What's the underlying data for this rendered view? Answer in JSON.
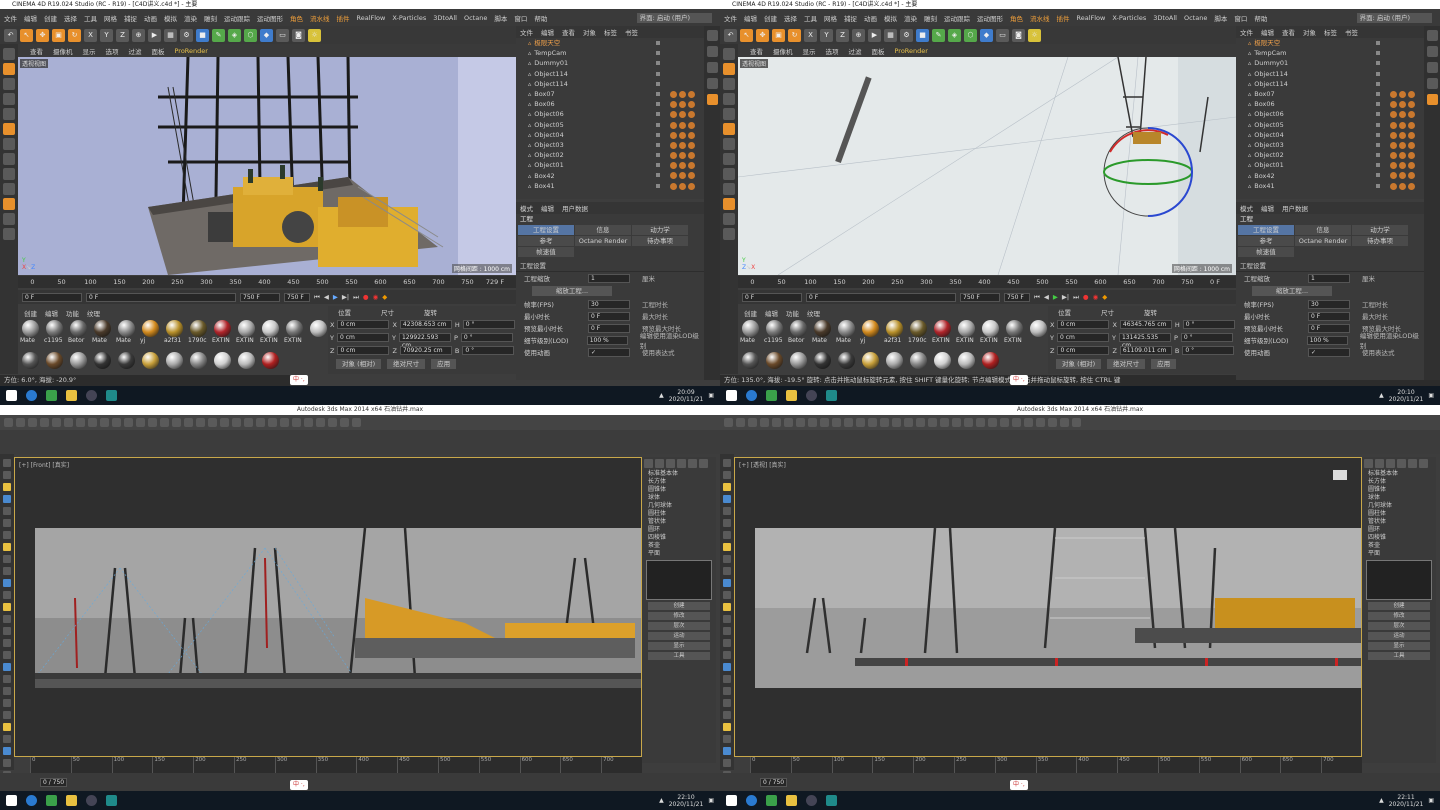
{
  "c4d_left": {
    "title": "CINEMA 4D R19.024 Studio (RC - R19) - [C4D讲义.c4d *] - 主要",
    "menus": [
      "文件",
      "编辑",
      "创建",
      "选择",
      "工具",
      "网格",
      "捕捉",
      "动画",
      "模拟",
      "渲染",
      "雕刻",
      "运动跟踪",
      "运动图形",
      "角色",
      "流水线",
      "插件",
      "RealFlow",
      "X-Particles",
      "3DtoAll",
      "Octane",
      "脚本",
      "窗口",
      "帮助"
    ],
    "layout_label": "界面",
    "layout_value": "启动 (用户)",
    "viewport_menus": [
      "查看",
      "摄像机",
      "显示",
      "选项",
      "过滤",
      "面板"
    ],
    "prorender": "ProRender",
    "viewport_name": "透视视图",
    "grid_spacing": "网格间距 : 1000 cm",
    "timeline_ticks": [
      "0",
      "50",
      "100",
      "150",
      "200",
      "250",
      "300",
      "350",
      "400",
      "450",
      "500",
      "550",
      "600",
      "650",
      "700",
      "750"
    ],
    "frame_end": "729 F",
    "transport": {
      "start": "0 F",
      "current": "0 F",
      "end": "750 F",
      "end2": "750 F"
    },
    "mat_tabs": [
      "创建",
      "编辑",
      "功能",
      "纹理"
    ],
    "materials": [
      {
        "name": "Mate",
        "color": "#9a9a9a"
      },
      {
        "name": "c1195",
        "color": "#7a7a7a"
      },
      {
        "name": "Betor",
        "color": "#6a6a6a"
      },
      {
        "name": "Mate",
        "color": "#4a3a2a"
      },
      {
        "name": "Mate",
        "color": "#8a8a8a"
      },
      {
        "name": "yj",
        "color": "#d28a1e"
      },
      {
        "name": "a2f31",
        "color": "#b8902a"
      },
      {
        "name": "1790c",
        "color": "#6a5a2a"
      },
      {
        "name": "EXTIN",
        "color": "#b0242a"
      },
      {
        "name": "EXTIN",
        "color": "#a8a8a8"
      },
      {
        "name": "EXTIN",
        "color": "#c8c8c8"
      },
      {
        "name": "EXTIN",
        "color": "#777"
      },
      {
        "name": "",
        "color": "#bcbcbc"
      },
      {
        "name": "",
        "color": "#555"
      },
      {
        "name": "",
        "color": "#6a4a2a"
      },
      {
        "name": "",
        "color": "#999"
      },
      {
        "name": "",
        "color": "#333"
      },
      {
        "name": "",
        "color": "#3a3a3a"
      },
      {
        "name": "",
        "color": "#c8a03a"
      },
      {
        "name": "",
        "color": "#aaa"
      },
      {
        "name": "",
        "color": "#888"
      },
      {
        "name": "",
        "color": "#d0d0d0"
      },
      {
        "name": "",
        "color": "#bbb"
      },
      {
        "name": "",
        "color": "#b02020"
      }
    ],
    "coords": {
      "headers": [
        "位置",
        "尺寸",
        "旋转"
      ],
      "rows": [
        {
          "axis": "X",
          "pos": "0 cm",
          "size": "42308.653 cm",
          "rl": "H",
          "rot": "0 °"
        },
        {
          "axis": "Y",
          "pos": "0 cm",
          "size": "129922.593 cm",
          "rl": "P",
          "rot": "0 °"
        },
        {
          "axis": "Z",
          "pos": "0 cm",
          "size": "70920.25 cm",
          "rl": "B",
          "rot": "0 °"
        }
      ],
      "mode": "对象 (相对)",
      "size_mode": "绝对尺寸",
      "apply": "应用"
    },
    "status": "方位: 6.0°, 海拔: -20.9°",
    "objects": [
      {
        "name": "极限天空",
        "sel": true
      },
      {
        "name": "TempCam"
      },
      {
        "name": "Dummy01"
      },
      {
        "name": "Object114"
      },
      {
        "name": "Object114"
      },
      {
        "name": "Box07"
      },
      {
        "name": "Box06"
      },
      {
        "name": "Object06"
      },
      {
        "name": "Object05"
      },
      {
        "name": "Object04"
      },
      {
        "name": "Object03"
      },
      {
        "name": "Object02"
      },
      {
        "name": "Object01"
      },
      {
        "name": "Box42"
      },
      {
        "name": "Box41"
      }
    ],
    "obj_menus": [
      "文件",
      "编辑",
      "查看",
      "对象",
      "标签",
      "书签"
    ],
    "attr_menus": [
      "模式",
      "编辑",
      "用户数据"
    ],
    "attr_title": "工程",
    "tabs": [
      "工程设置",
      "信息",
      "动力学",
      "参考",
      "Octane Render",
      "待办事项",
      "帧速值"
    ],
    "section": "工程设置",
    "settings": [
      {
        "label": "工程缩放",
        "value": "1",
        "right": "厘米"
      },
      {
        "label": "帧率(FPS)",
        "value": "30",
        "right": "工程时长"
      },
      {
        "label": "最小时长",
        "value": "0 F",
        "right": "最大时长"
      },
      {
        "label": "预览最小时长",
        "value": "0 F",
        "right": "预览最大时长"
      },
      {
        "label": "细节级别(LOD)",
        "value": "100 %",
        "right": "编辑使用渲染LOD级别"
      },
      {
        "label": "使用动画",
        "value": "✓",
        "right": "使用表达式"
      }
    ],
    "scale_btn": "缩放工程...",
    "tray_time": "20:09",
    "tray_date": "2020/11/21"
  },
  "c4d_right": {
    "title": "CINEMA 4D R19.024 Studio (RC - R19) - [C4D讲义.c4d *] - 主要",
    "grid_spacing": "网格间距 : 1000 cm",
    "frame_end": "0 F",
    "transport": {
      "start": "0 F",
      "current": "0 F",
      "end": "750 F",
      "end2": "750 F"
    },
    "coords": {
      "rows": [
        {
          "axis": "X",
          "pos": "0 cm",
          "size": "46345.765 cm",
          "rl": "H",
          "rot": "0 °"
        },
        {
          "axis": "Y",
          "pos": "0 cm",
          "size": "131425.535 cm",
          "rl": "P",
          "rot": "0 °"
        },
        {
          "axis": "Z",
          "pos": "0 cm",
          "size": "61109.011 cm",
          "rl": "B",
          "rot": "0 °"
        }
      ]
    },
    "status": "方位: 135.0°, 海拔: -19.5° 旋转: 点击并拖动鼠标旋转元素, 按住 SHIFT 键量化旋转; 节点编辑模式时点击并拖动鼠标旋转, 按住 CTRL 键",
    "tray_time": "20:10",
    "tray_date": "2020/11/21"
  },
  "max_left": {
    "title": "Autodesk 3ds Max 2014 x64   石油钻井.max",
    "viewport_label": "[+] [Front] [真实]",
    "cmd_rows": [
      "标准基本体",
      "长方体",
      "圆锥体",
      "球体",
      "几何球体",
      "圆柱体",
      "管状体",
      "圆环",
      "四棱锥",
      "茶壶",
      "平面"
    ],
    "cmd_btns": [
      "创建",
      "修改",
      "层次",
      "运动",
      "显示",
      "工具"
    ],
    "track_ticks": [
      "0",
      "50",
      "100",
      "150",
      "200",
      "250",
      "300",
      "350",
      "400",
      "450",
      "500",
      "550",
      "600",
      "650",
      "700"
    ],
    "frame": "0 / 750",
    "tray_time": "22:10",
    "tray_date": "2020/11/21"
  },
  "max_right": {
    "title": "Autodesk 3ds Max 2014 x64   石油钻井.max",
    "viewport_label": "[+] [透视] [真实]",
    "tray_time": "22:11",
    "tray_date": "2020/11/21"
  },
  "ime_label": "中 ·,",
  "colors": {
    "accent": "#f4a23a",
    "select_blue": "#5575a4",
    "max_border": "#c9a84a"
  }
}
